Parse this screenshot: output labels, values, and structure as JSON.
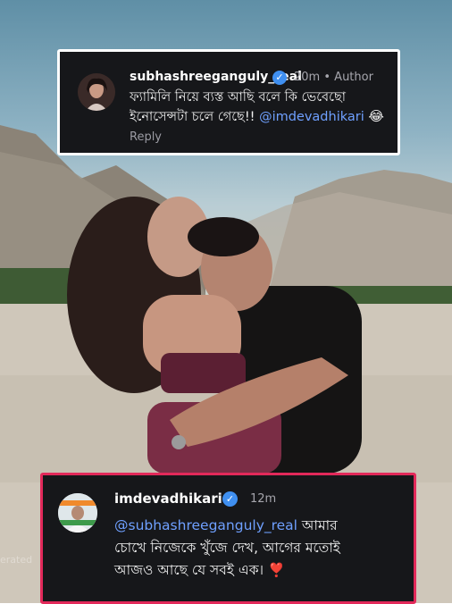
{
  "top_comment": {
    "username": "subhashreeganguly_real",
    "time": "20m",
    "separator": "•",
    "author_label": "Author",
    "text_line1": "ফ্যামিলি নিয়ে ব্যস্ত আছি বলে কি ভেবেছো",
    "text_line2": "ইনোসেন্সটা চলে গেছে!!",
    "mention": "@imdevadhikari",
    "emoji": "😂",
    "reply_label": "Reply"
  },
  "bottom_comment": {
    "username": "imdevadhikari",
    "time": "12m",
    "mention": "@subhashreeganguly_real",
    "text_line1_rest": " আমার",
    "text_line2": "চোখে নিজেকে খুঁজে দেখ, আগের মতোই",
    "text_line3": "আজও আছে যে সবই এক।",
    "emoji": "❣️"
  },
  "watermark": "erated",
  "colors": {
    "card_bg": "#16171a",
    "top_border": "#ffffff",
    "bottom_border": "#e2295a",
    "mention": "#6fa0ff",
    "verified": "#3f8ff0"
  },
  "icons": [
    "verified-badge-icon",
    "heart-exclamation-icon"
  ]
}
